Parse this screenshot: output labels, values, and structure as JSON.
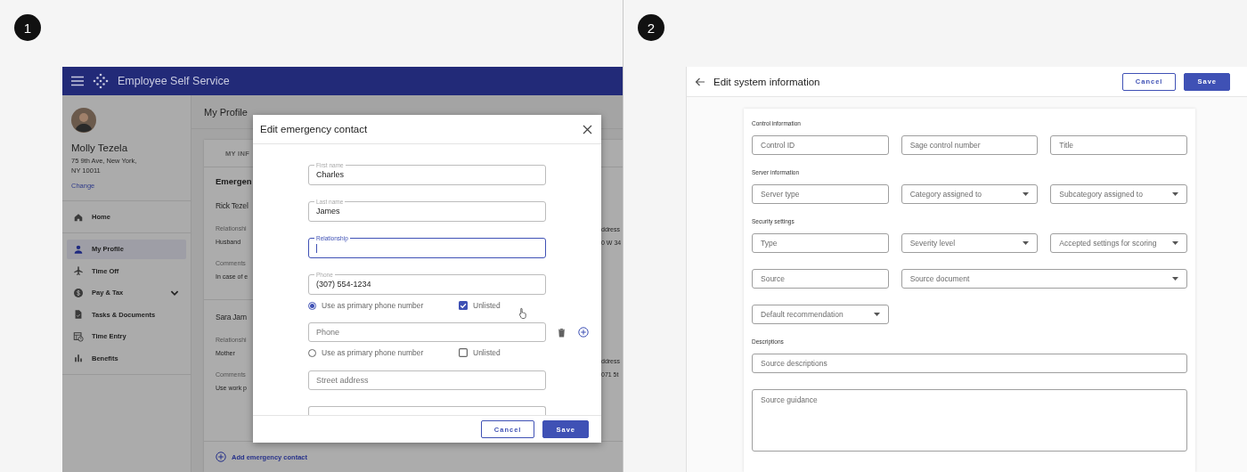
{
  "screen_1": {
    "step": "1",
    "app": {
      "title": "Employee Self Service",
      "user": {
        "name": "Molly Tezela",
        "address_lines": [
          "75 9th Ave, New York,",
          "NY 10011"
        ],
        "link": "Change"
      },
      "nav_groups": [
        {
          "items": [
            {
              "label": "Home",
              "selected": false,
              "expandable": false
            }
          ]
        },
        {
          "items": [
            {
              "label": "My Profile",
              "selected": true,
              "expandable": false
            },
            {
              "label": "Time Off",
              "selected": false,
              "expandable": false
            },
            {
              "label": "Pay & Tax",
              "selected": false,
              "expandable": true
            },
            {
              "label": "Tasks & Documents",
              "selected": false,
              "expandable": false
            },
            {
              "label": "Time Entry",
              "selected": false,
              "expandable": false
            },
            {
              "label": "Benefits",
              "selected": false,
              "expandable": false
            }
          ]
        }
      ],
      "page_title": "My Profile",
      "tab": "MY INF",
      "section_title": "Emergen",
      "contacts": [
        {
          "name": "Rick Tezel",
          "relationship_label": "Relationshi",
          "relationship": "Husband",
          "comments_label": "Comments",
          "comments": "In case of e",
          "address_label": "ddress",
          "address": "0 W 34"
        },
        {
          "name": "Sara Jam",
          "relationship_label": "Relationshi",
          "relationship": "Mother",
          "comments_label": "Comments",
          "comments": "Use work p",
          "address_label": "ddress",
          "address": "071 5t"
        }
      ],
      "add_link": "Add emergency contact",
      "dialog": {
        "title": "Edit emergency contact",
        "rows": [
          {
            "kind": "field",
            "label": "First name",
            "value": "Charles",
            "focused": false
          },
          {
            "kind": "field",
            "label": "Last name",
            "value": "James",
            "focused": false
          },
          {
            "kind": "field",
            "label": "Relationship",
            "focused": true
          },
          {
            "kind": "field",
            "label": "Phone",
            "value": "(307) 554-1234",
            "focused": false
          },
          {
            "kind": "options",
            "radio_label": "Use as primary phone number",
            "selected": true,
            "checkbox_label": "Unlisted",
            "checked": true
          },
          {
            "kind": "phone",
            "placeholder": "Phone",
            "focused": false
          },
          {
            "kind": "options",
            "radio_label": "Use as primary phone number",
            "selected": false,
            "checkbox_label": "Unlisted",
            "checked": false
          },
          {
            "kind": "field",
            "placeholder": "Street address",
            "focused": false
          },
          {
            "kind": "cut"
          }
        ],
        "buttons": [
          {
            "label": "Cancel",
            "kind": "outlined"
          },
          {
            "label": "Save",
            "kind": "filled"
          }
        ]
      }
    }
  },
  "screen_2": {
    "step": "2",
    "app": {
      "title": "Edit system information",
      "buttons": [
        {
          "label": "Cancel",
          "kind": "outlined"
        },
        {
          "label": "Save",
          "kind": "filled"
        }
      ],
      "sections": [
        {
          "title": "Control information",
          "rows": [
            [
              {
                "placeholder": "Control ID",
                "kind": "text"
              },
              {
                "placeholder": "Sage control number",
                "kind": "text"
              },
              {
                "placeholder": "Title",
                "kind": "text"
              }
            ]
          ]
        },
        {
          "title": "Server information",
          "rows": [
            [
              {
                "placeholder": "Server type",
                "kind": "text"
              },
              {
                "placeholder": "Category assigned to",
                "kind": "select"
              },
              {
                "placeholder": "Subcategory assigned to",
                "kind": "select"
              }
            ]
          ]
        },
        {
          "title": "Security settings",
          "rows": [
            [
              {
                "placeholder": "Type",
                "kind": "text"
              },
              {
                "placeholder": "Severity level",
                "kind": "select"
              },
              {
                "placeholder": "Accepted settings for scoring",
                "kind": "select"
              }
            ],
            [
              {
                "placeholder": "Source",
                "kind": "text"
              },
              {
                "placeholder": "Source document",
                "kind": "select",
                "wide": true
              }
            ],
            [
              {
                "placeholder": "Default recommendation",
                "kind": "select"
              }
            ]
          ]
        },
        {
          "title": "Descriptions",
          "rows": [
            [
              {
                "placeholder": "Source descriptions",
                "kind": "text",
                "wide": true
              }
            ],
            [
              {
                "placeholder": "Source guidance",
                "kind": "textarea",
                "wide": true
              }
            ]
          ]
        }
      ]
    }
  }
}
